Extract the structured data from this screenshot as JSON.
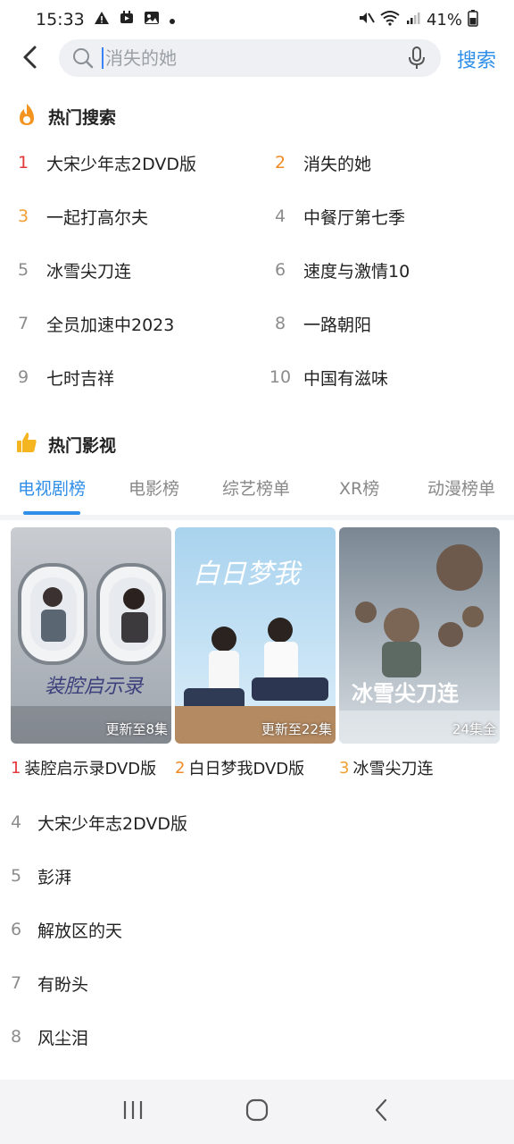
{
  "status": {
    "time": "15:33",
    "battery": "41%"
  },
  "search": {
    "placeholder": "消失的她",
    "button_label": "搜索"
  },
  "hot_search": {
    "title": "热门搜索",
    "items": [
      {
        "rank": "1",
        "name": "大宋少年志2DVD版"
      },
      {
        "rank": "2",
        "name": "消失的她"
      },
      {
        "rank": "3",
        "name": "一起打高尔夫"
      },
      {
        "rank": "4",
        "name": "中餐厅第七季"
      },
      {
        "rank": "5",
        "name": "冰雪尖刀连"
      },
      {
        "rank": "6",
        "name": "速度与激情10"
      },
      {
        "rank": "7",
        "name": "全员加速中2023"
      },
      {
        "rank": "8",
        "name": "一路朝阳"
      },
      {
        "rank": "9",
        "name": "七时吉祥"
      },
      {
        "rank": "10",
        "name": "中国有滋味"
      }
    ]
  },
  "hot_video": {
    "title": "热门影视",
    "tabs": [
      {
        "label": "电视剧榜",
        "active": true
      },
      {
        "label": "电影榜",
        "active": false
      },
      {
        "label": "综艺榜单",
        "active": false
      },
      {
        "label": "XR榜",
        "active": false
      },
      {
        "label": "动漫榜单",
        "active": false
      }
    ],
    "posters": [
      {
        "rank": "1",
        "name": "装腔启示录DVD版",
        "badge": "更新至8集",
        "poster_text": "装腔启示录"
      },
      {
        "rank": "2",
        "name": "白日梦我DVD版",
        "badge": "更新至22集",
        "poster_text": "白日梦我"
      },
      {
        "rank": "3",
        "name": "冰雪尖刀连",
        "badge": "24集全",
        "poster_text": "冰雪尖刀连"
      }
    ],
    "list": [
      {
        "rank": "4",
        "name": "大宋少年志2DVD版"
      },
      {
        "rank": "5",
        "name": "彭湃"
      },
      {
        "rank": "6",
        "name": "解放区的天"
      },
      {
        "rank": "7",
        "name": "有盼头"
      },
      {
        "rank": "8",
        "name": "风尘泪"
      }
    ]
  },
  "colors": {
    "accent": "#2e8ee8",
    "rank1": "#e5383b",
    "rank2": "#f08a24",
    "rank3": "#f0a030",
    "rank_other": "#8c8c8c"
  }
}
